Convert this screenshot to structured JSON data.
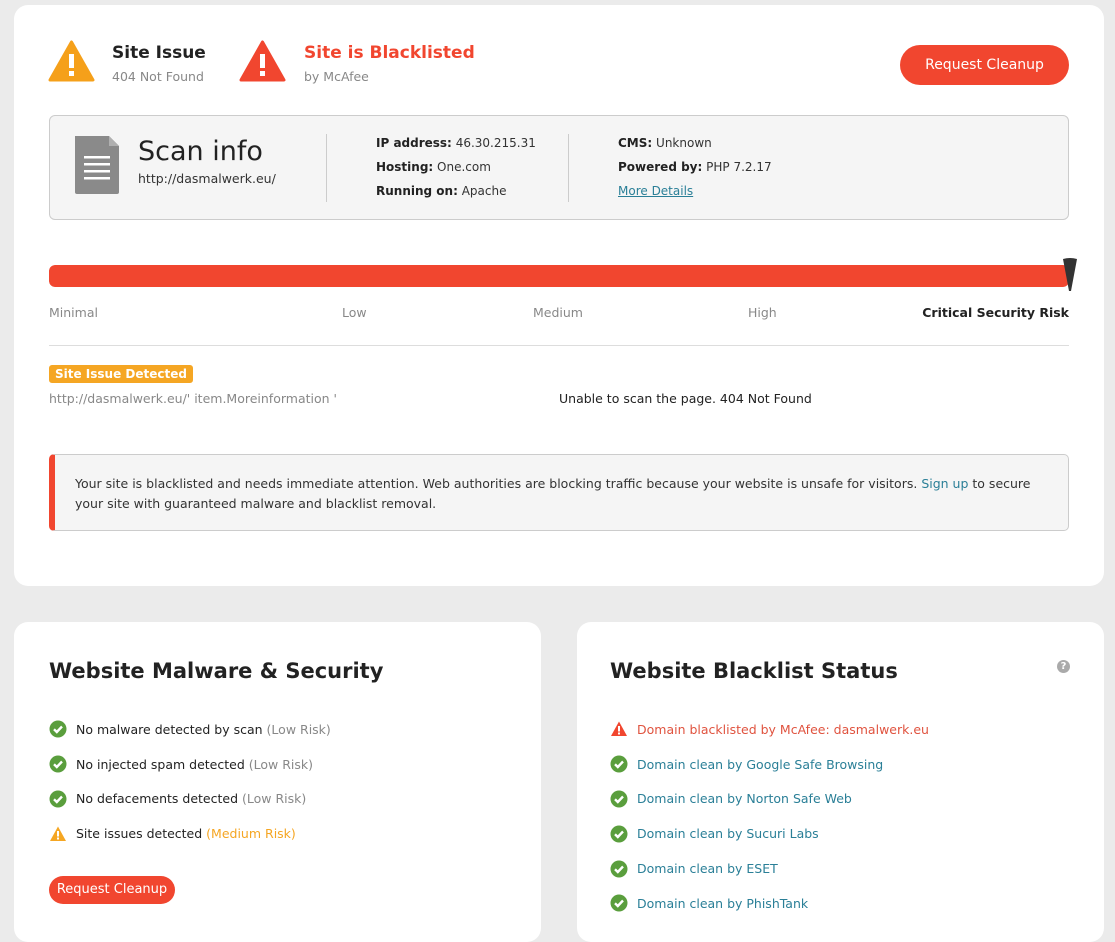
{
  "header": {
    "issue_title": "Site Issue",
    "issue_sub": "404 Not Found",
    "blacklist_title": "Site is Blacklisted",
    "blacklist_sub": "by McAfee",
    "request_cleanup": "Request Cleanup"
  },
  "scan": {
    "title": "Scan info",
    "url": "http://dasmalwerk.eu/",
    "ip_label": "IP address:",
    "ip": "46.30.215.31",
    "hosting_label": "Hosting:",
    "hosting": "One.com",
    "running_label": "Running on:",
    "running": "Apache",
    "cms_label": "CMS:",
    "cms": "Unknown",
    "powered_label": "Powered by:",
    "powered": "PHP 7.2.17",
    "more_details": "More Details"
  },
  "risk": {
    "level_fraction": 1.0,
    "bar_color": "#f1462f",
    "labels": [
      "Minimal",
      "Low",
      "Medium",
      "High",
      "Critical Security Risk"
    ]
  },
  "issue": {
    "badge": "Site Issue Detected",
    "path": "http://dasmalwerk.eu/' item.Moreinformation '",
    "message": "Unable to scan the page. 404 Not Found"
  },
  "alert": {
    "text_before": "Your site is blacklisted and needs immediate attention. Web authorities are blocking traffic because your website is unsafe for visitors.",
    "link": "Sign up",
    "text_after": "to secure your site with guaranteed malware and blacklist removal."
  },
  "malware": {
    "title": "Website Malware & Security",
    "items": [
      {
        "text": "No malware detected by scan",
        "risk": "(Low Risk)",
        "icon": "check-circle"
      },
      {
        "text": "No injected spam detected",
        "risk": "(Low Risk)",
        "icon": "check-circle"
      },
      {
        "text": "No defacements detected",
        "risk": "(Low Risk)",
        "icon": "check-circle"
      },
      {
        "text": "Site issues detected",
        "risk": "(Medium Risk)",
        "icon": "warning"
      }
    ],
    "button": "Request Cleanup"
  },
  "blacklist": {
    "title": "Website Blacklist Status",
    "items": [
      {
        "text": "Domain blacklisted by McAfee: dasmalwerk.eu",
        "icon": "warning"
      },
      {
        "text": "Domain clean by Google Safe Browsing",
        "icon": "check-circle"
      },
      {
        "text": "Domain clean by Norton Safe Web",
        "icon": "check-circle"
      },
      {
        "text": "Domain clean by Sucuri Labs",
        "icon": "check-circle"
      },
      {
        "text": "Domain clean by ESET",
        "icon": "check-circle"
      },
      {
        "text": "Domain clean by PhishTank",
        "icon": "check-circle"
      }
    ]
  },
  "colors": {
    "red": "#f1462f",
    "orange": "#f5a623",
    "green": "#5a9e3d",
    "link": "#2a7f97"
  }
}
